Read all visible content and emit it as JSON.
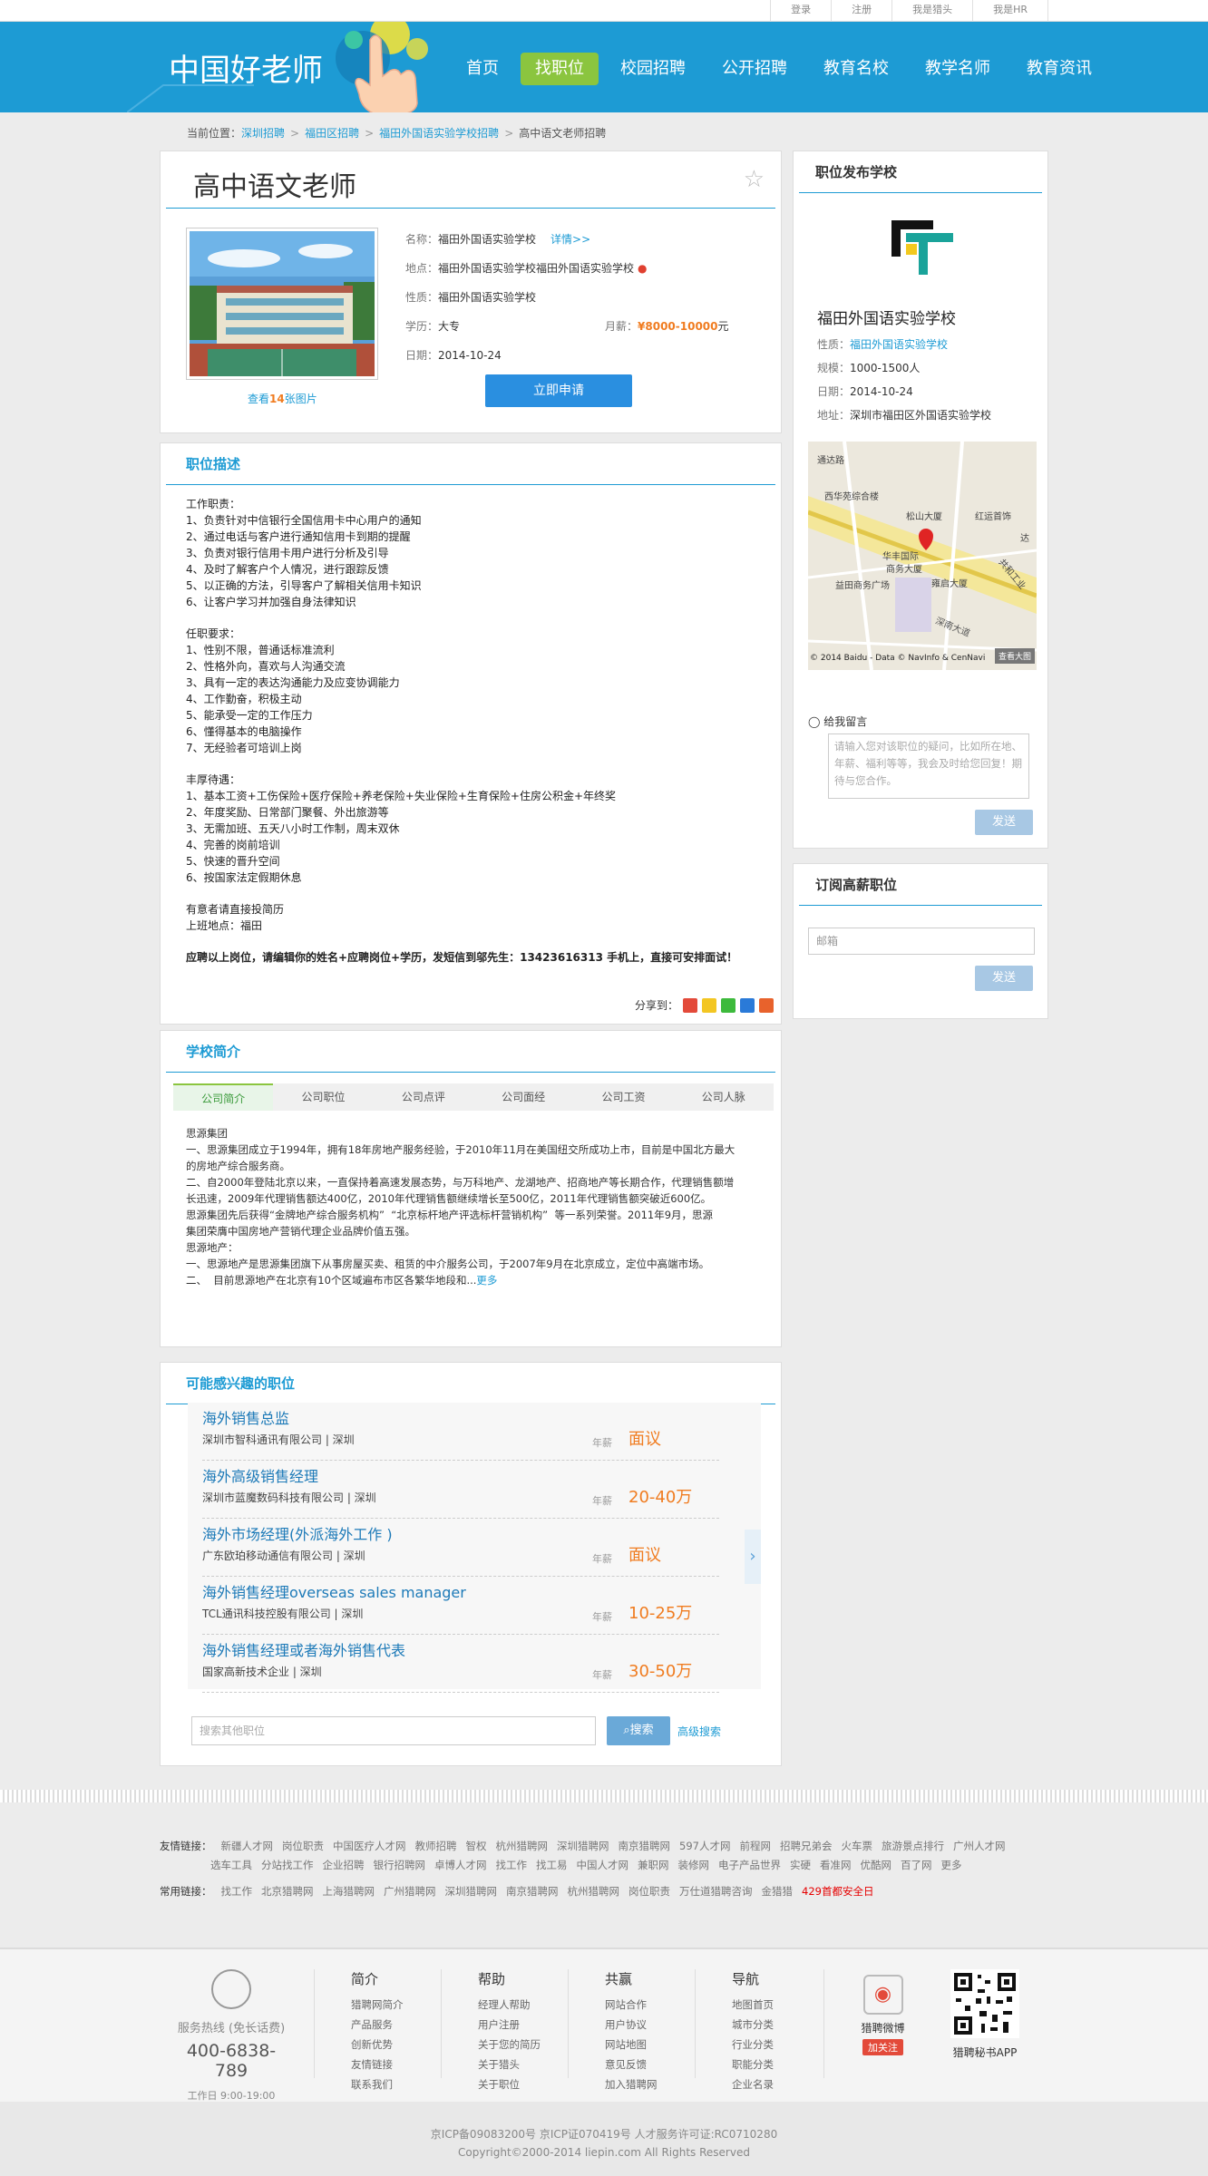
{
  "topbar": {
    "links": [
      "登录",
      "注册",
      "我是猎头",
      "我是HR"
    ]
  },
  "header": {
    "logo": "中国好老师",
    "nav": [
      "首页",
      "找职位",
      "校园招聘",
      "公开招聘",
      "教育名校",
      "教学名师",
      "教育资讯"
    ],
    "active_index": 1,
    "colors": {
      "header": "#1d9bd4",
      "active": "#8bc53f"
    }
  },
  "breadcrumb": {
    "prefix": "当前位置：",
    "items": [
      "深圳招聘",
      "福田区招聘",
      "福田外国语实验学校招聘"
    ],
    "current": "高中语文老师招聘",
    "sep": ">"
  },
  "job": {
    "title": "高中语文老师",
    "name_label": "名称：",
    "name": "福田外国语实验学校",
    "detail_link": "详情>>",
    "addr_label": "地点：",
    "addr": "福田外国语实验学校福田外国语实验学校",
    "type_label": "性质：",
    "type": "福田外国语实验学校",
    "edu_label": "学历：",
    "edu": "大专",
    "salary_label": "月薪：",
    "salary": "¥8000-10000",
    "salary_unit": "元",
    "date_label": "日期：",
    "date": "2014-10-24",
    "photo_prefix": "查看",
    "photo_count": "14",
    "photo_suffix": "张图片",
    "apply_label": "立即申请"
  },
  "description": {
    "title": "职位描述",
    "blocks": [
      [
        "工作职责：",
        "1、负责针对中信银行全国信用卡中心用户的通知",
        "2、通过电话与客户进行通知信用卡到期的提醒",
        "3、负责对银行信用卡用户进行分析及引导",
        "4、及时了解客户个人情况，进行跟踪反馈",
        "5、以正确的方法，引导客户了解相关信用卡知识",
        "6、让客户学习并加强自身法律知识"
      ],
      [
        "任职要求：",
        "1、性别不限，普通话标准流利",
        "2、性格外向，喜欢与人沟通交流",
        "3、具有一定的表达沟通能力及应变协调能力",
        "4、工作勤奋，积极主动",
        "5、能承受一定的工作压力",
        "6、懂得基本的电脑操作",
        "7、无经验者可培训上岗"
      ],
      [
        "丰厚待遇：",
        "1、基本工资+工伤保险+医疗保险+养老保险+失业保险+生育保险+住房公积金+年终奖",
        "2、年度奖励、日常部门聚餐、外出旅游等",
        "3、无需加班、五天八小时工作制，周末双休",
        "4、完善的岗前培训",
        "5、快速的晋升空间",
        "6、按国家法定假期休息"
      ],
      [
        "有意者请直接投简历",
        "上班地点：福田"
      ]
    ],
    "footer": "应聘以上岗位，请编辑你的姓名+应聘岗位+学历，发短信到邬先生：13423616313 手机上，直接可安排面试！",
    "share_label": "分享到："
  },
  "school_intro": {
    "title": "学校简介",
    "tabs": [
      "公司简介",
      "公司职位",
      "公司点评",
      "公司面经",
      "公司工资",
      "公司人脉"
    ],
    "lines": [
      "思源集团",
      "一、思源集团成立于1994年，拥有18年房地产服务经验，于2010年11月在美国纽交所成功上市，目前是中国北方最大",
      "的房地产综合服务商。",
      "二、自2000年登陆北京以来，一直保持着高速发展态势，与万科地产、龙湖地产、招商地产等长期合作，代理销售额增",
      "长迅速，2009年代理销售额达400亿，2010年代理销售额继续增长至500亿，2011年代理销售额突破近600亿。",
      "思源集团先后获得“金牌地产综合服务机构”  “北京标杆地产评选标杆营销机构”  等一系列荣誉。2011年9月，思源",
      "集团荣膺中国房地产营销代理企业品牌价值五强。",
      "思源地产：",
      "一、思源地产是思源集团旗下从事房屋买卖、租赁的中介服务公司，于2007年9月在北京成立，定位中高端市场。",
      "二、  目前思源地产在北京有10个区域遍布市区各繁华地段和..."
    ],
    "more": "更多"
  },
  "recommend": {
    "title": "可能感兴趣的职位",
    "salary_label": "年薪",
    "items": [
      {
        "title": "海外销售总监",
        "company": "深圳市智科通讯有限公司 | 深圳",
        "salary": "面议"
      },
      {
        "title": "海外高级销售经理",
        "company": "深圳市蓝魔数码科技有限公司 | 深圳",
        "salary": "20-40万"
      },
      {
        "title": "海外市场经理(外派海外工作 )",
        "company": "广东欧珀移动通信有限公司 | 深圳",
        "salary": "面议"
      },
      {
        "title": "海外销售经理overseas sales manager",
        "company": "TCL通讯科技控股有限公司 | 深圳",
        "salary": "10-25万"
      },
      {
        "title": "海外销售经理或者海外销售代表",
        "company": "国家高新技术企业 | 深圳",
        "salary": "30-50万"
      }
    ],
    "search_placeholder": "搜索其他职位",
    "search_btn": "搜索",
    "advanced": "高级搜索"
  },
  "school": {
    "title": "职位发布学校",
    "name": "福田外国语实验学校",
    "type_label": "性质：",
    "type": "福田外国语实验学校",
    "scale_label": "规模：",
    "scale": "1000-1500人",
    "date_label": "日期：",
    "date": "2014-10-24",
    "addr_label": "地址：",
    "addr": "深圳市福田区外国语实验学校",
    "map_labels": [
      "通达路",
      "西华苑综合楼",
      "松山大厦",
      "红运首饰",
      "达",
      "华丰国际",
      "商务大厦",
      "益田商务广场",
      "雍启大厦",
      "共和工业",
      "深南大道"
    ],
    "map_credit": "© 2014 Baidu - Data © NavInfo & CenNavi",
    "map_view": "查看大图",
    "msg_label": "给我留言",
    "msg_placeholder": "请输入您对该职位的疑问，比如所在地、年薪、福利等等，我会及时给您回复！期待与您合作。",
    "send": "发送"
  },
  "subscribe": {
    "title": "订阅高薪职位",
    "placeholder": "邮箱",
    "send": "发送"
  },
  "friend_links": {
    "label": "友情链接：",
    "row1": [
      "新疆人才网",
      "岗位职责",
      "中国医疗人才网",
      "教师招聘",
      "智权",
      "杭州猎聘网",
      "深圳猎聘网",
      "南京猎聘网",
      "597人才网",
      "前程网",
      "招聘兄弟会",
      "火车票",
      "旅游景点排行",
      "广州人才网"
    ],
    "row2": [
      "选车工具",
      "分站找工作",
      "企业招聘",
      "银行招聘网",
      "卓博人才网",
      "找工作",
      "找工易",
      "中国人才网",
      "兼职网",
      "装修网",
      "电子产品世界",
      "实硬",
      "看准网",
      "优酷网",
      "百了网",
      "更多"
    ]
  },
  "common_links": {
    "label": "常用链接：",
    "items": [
      "找工作",
      "北京猎聘网",
      "上海猎聘网",
      "广州猎聘网",
      "深圳猎聘网",
      "南京猎聘网",
      "杭州猎聘网",
      "岗位职责",
      "万仕道猎聘咨询",
      "金猎猎"
    ],
    "red": "429首都安全日"
  },
  "footer": {
    "service": "服务热线 (免长话费)",
    "tel": "400-6838-789",
    "hours": "工作日 9:00-19:00",
    "cols": [
      {
        "title": "简介",
        "items": [
          "猎聘网简介",
          "产品服务",
          "创新优势",
          "友情链接",
          "联系我们"
        ]
      },
      {
        "title": "帮助",
        "items": [
          "经理人帮助",
          "用户注册",
          "关于您的简历",
          "关于猎头",
          "关于职位"
        ]
      },
      {
        "title": "共赢",
        "items": [
          "网站合作",
          "用户协议",
          "网站地图",
          "意见反馈",
          "加入猎聘网"
        ]
      },
      {
        "title": "导航",
        "items": [
          "地图首页",
          "城市分类",
          "行业分类",
          "职能分类",
          "企业名录"
        ]
      }
    ],
    "weibo": "猎聘微博",
    "follow": "加关注",
    "app": "猎聘秘书APP",
    "icp": "京ICP备09083200号 京ICP证070419号 人才服务许可证:RC0710280",
    "copyright": "Copyright©2000-2014 liepin.com All Rights Reserved"
  }
}
